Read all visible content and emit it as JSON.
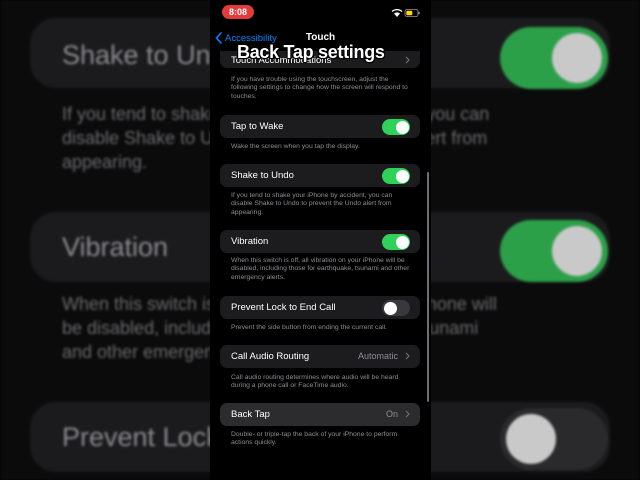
{
  "background": {
    "shake_title": "Shake to Undo",
    "shake_desc": "If you tend to shake your iPhone by accident, you can\ndisable Shake to Undo to prevent the Undo alert from\nappearing.",
    "vibration_title": "Vibration",
    "vibration_desc": "When this switch is off, all vibration on your iPhone will\nbe disabled, including those for earthquake, tsunami\nand other emergency alerts.",
    "prevent_title": "Prevent Lock to End Call"
  },
  "status": {
    "time": "8:08"
  },
  "nav": {
    "back_label": "Accessibility",
    "title": "Touch"
  },
  "overlay_title": "Back Tap settings",
  "top_row_label": "Touch Accommodations",
  "sections": [
    {
      "label": "",
      "value": "",
      "toggle": null,
      "footer": "If you have trouble using the touchscreen, adjust the following settings to change how the screen will respond to touches."
    },
    {
      "label": "Tap to Wake",
      "value": "",
      "toggle": "on",
      "footer": "Wake the screen when you tap the display."
    },
    {
      "label": "Shake to Undo",
      "value": "",
      "toggle": "on",
      "footer": "If you tend to shake your iPhone by accident, you can disable Shake to Undo to prevent the Undo alert from appearing."
    },
    {
      "label": "Vibration",
      "value": "",
      "toggle": "on",
      "footer": "When this switch is off, all vibration on your iPhone will be disabled, including those for earthquake, tsunami and other emergency alerts."
    },
    {
      "label": "Prevent Lock to End Call",
      "value": "",
      "toggle": "off",
      "footer": "Prevent the side button from ending the current call."
    },
    {
      "label": "Call Audio Routing",
      "value": "Automatic",
      "toggle": null,
      "footer": "Call audio routing determines where audio will be heard during a phone call or FaceTime audio."
    },
    {
      "label": "Back Tap",
      "value": "On",
      "toggle": null,
      "footer": "Double- or triple-tap the back of your iPhone to perform actions quickly."
    }
  ],
  "colors": {
    "accent": "#0a84ff",
    "toggle_on": "#30d158",
    "status_pill": "#e23b3b"
  },
  "icons": [
    "chevron-left-icon",
    "chevron-right-icon",
    "wifi-icon",
    "battery-icon"
  ]
}
